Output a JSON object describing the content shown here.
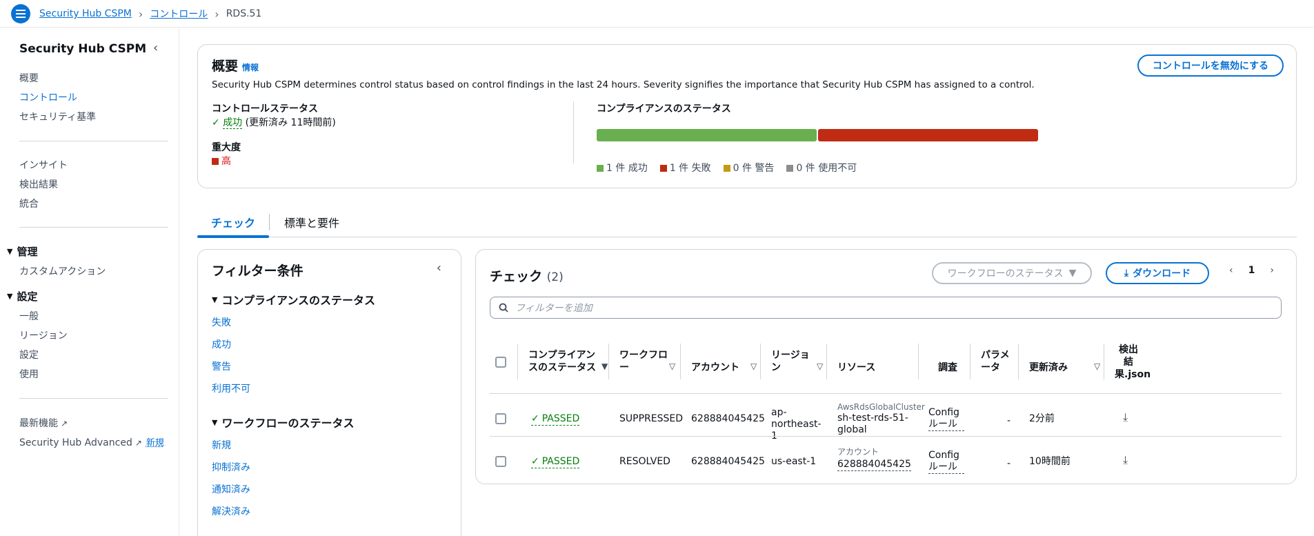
{
  "breadcrumb": {
    "items": [
      "Security Hub CSPM",
      "コントロール",
      "RDS.51"
    ]
  },
  "sidebar": {
    "title": "Security Hub CSPM",
    "group1": [
      "概要",
      "コントロール",
      "セキュリティ基準"
    ],
    "group2": [
      "インサイト",
      "検出結果",
      "統合"
    ],
    "manage_heading": "管理",
    "manage_items": [
      "カスタムアクション"
    ],
    "settings_heading": "設定",
    "settings_items": [
      "一般",
      "リージョン",
      "設定",
      "使用"
    ],
    "footer_items": [
      "最新機能",
      "Security Hub Advanced"
    ],
    "new_badge": "新規"
  },
  "overview": {
    "title": "概要",
    "info": "情報",
    "description": "Security Hub CSPM determines control status based on control findings in the last 24 hours. Severity signifies the importance that Security Hub CSPM has assigned to a control.",
    "disable_button": "コントロールを無効にする",
    "control_status_label": "コントロールステータス",
    "control_status_value": "成功",
    "control_status_note": "(更新済み 11時間前)",
    "severity_label": "重大度",
    "severity_value": "高",
    "compliance_label": "コンプライアンスのステータス",
    "compliance": {
      "passed": 1,
      "failed": 1,
      "warning": 0,
      "not_available": 0
    },
    "legend": [
      "1 件 成功",
      "1 件 失敗",
      "0 件 警告",
      "0 件 使用不可"
    ],
    "colors": {
      "passed": "#6aaf4f",
      "failed": "#bf2b13",
      "warning": "#c49a14",
      "na": "#8d8d8d"
    }
  },
  "tabs": [
    "チェック",
    "標準と要件"
  ],
  "filter": {
    "title": "フィルター条件",
    "section1": "コンプライアンスのステータス",
    "section1_items": [
      "失敗",
      "成功",
      "警告",
      "利用不可"
    ],
    "section2": "ワークフローのステータス",
    "section2_items": [
      "新規",
      "抑制済み",
      "通知済み",
      "解決済み"
    ]
  },
  "checks": {
    "title": "チェック",
    "count": "(2)",
    "workflow_dropdown": "ワークフローのステータス",
    "download_button": "ダウンロード",
    "page": "1",
    "search_placeholder": "フィルターを追加",
    "columns": {
      "compliance": "コンプライアンスのステータス",
      "workflow": "ワークフロー",
      "account": "アカウント",
      "region": "リージョン",
      "resource": "リソース",
      "investigate": "調査",
      "parameters": "パラメータ",
      "updated": "更新済み",
      "json": "検出結果.json"
    },
    "rows": [
      {
        "status": "PASSED",
        "workflow": "SUPPRESSED",
        "account": "628884045425",
        "region": "ap-northeast-1",
        "resource_type": "AwsRdsGlobalCluster",
        "resource_id": "sh-test-rds-51-global",
        "investigate": "Config ルール",
        "parameters": "-",
        "updated": "2分前"
      },
      {
        "status": "PASSED",
        "workflow": "RESOLVED",
        "account": "628884045425",
        "region": "us-east-1",
        "resource_type": "アカウント",
        "resource_id": "628884045425",
        "investigate": "Config ルール",
        "parameters": "-",
        "updated": "10時間前"
      }
    ]
  }
}
